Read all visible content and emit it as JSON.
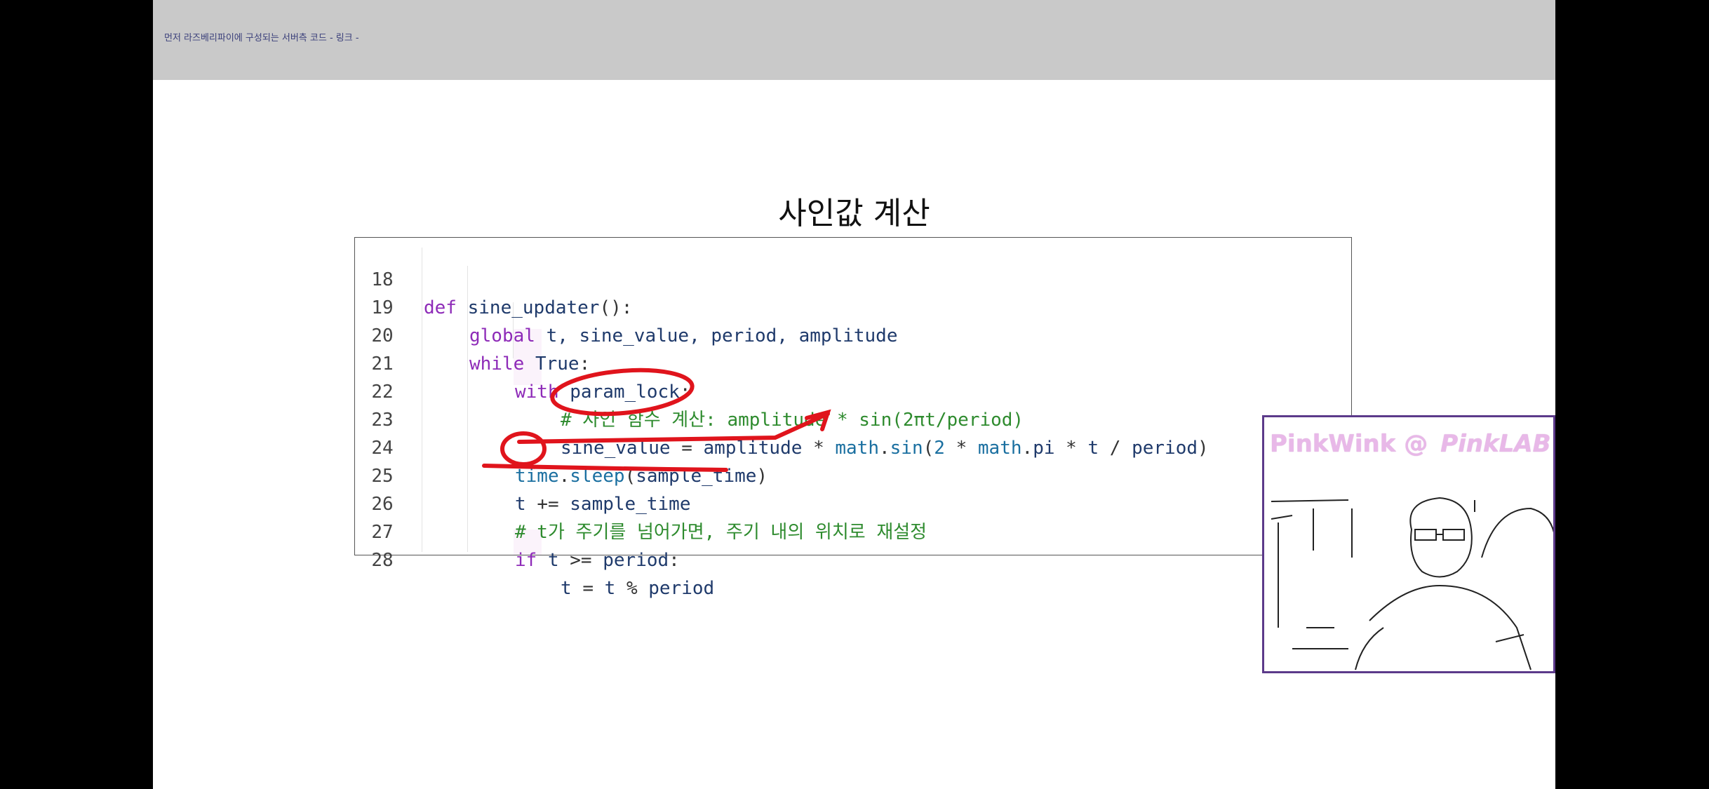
{
  "topbar": {
    "label": "먼저 라즈베리파이에 구성되는 서버측 코드 - 링크 -"
  },
  "slide": {
    "title": "사인값 계산"
  },
  "code": {
    "lines": [
      {
        "num": "18",
        "text": "def sine_updater():"
      },
      {
        "num": "19",
        "text": "global t, sine_value, period, amplitude"
      },
      {
        "num": "20",
        "text": "while True:"
      },
      {
        "num": "21",
        "text": "with param_lock:"
      },
      {
        "num": "22",
        "text": "# 사인 함수 계산: amplitude * sin(2πt/period)"
      },
      {
        "num": "23",
        "text": "sine_value = amplitude * math.sin(2 * math.pi * t / period)"
      },
      {
        "num": "24",
        "text": "time.sleep(sample_time)"
      },
      {
        "num": "25",
        "text": "t += sample_time"
      },
      {
        "num": "26",
        "text": "# t가 주기를 넘어가면, 주기 내의 위치로 재설정"
      },
      {
        "num": "27",
        "text": "if t >= period:"
      },
      {
        "num": "28",
        "text": "t = t % period"
      }
    ]
  },
  "webcam": {
    "label": "PinkWink @",
    "brand": "PinkLAB"
  },
  "colors": {
    "annotation": "#e0141c",
    "keyword": "#8e2bb8",
    "comment": "#2e8b2e",
    "webcam_border": "#5c3a8a"
  }
}
